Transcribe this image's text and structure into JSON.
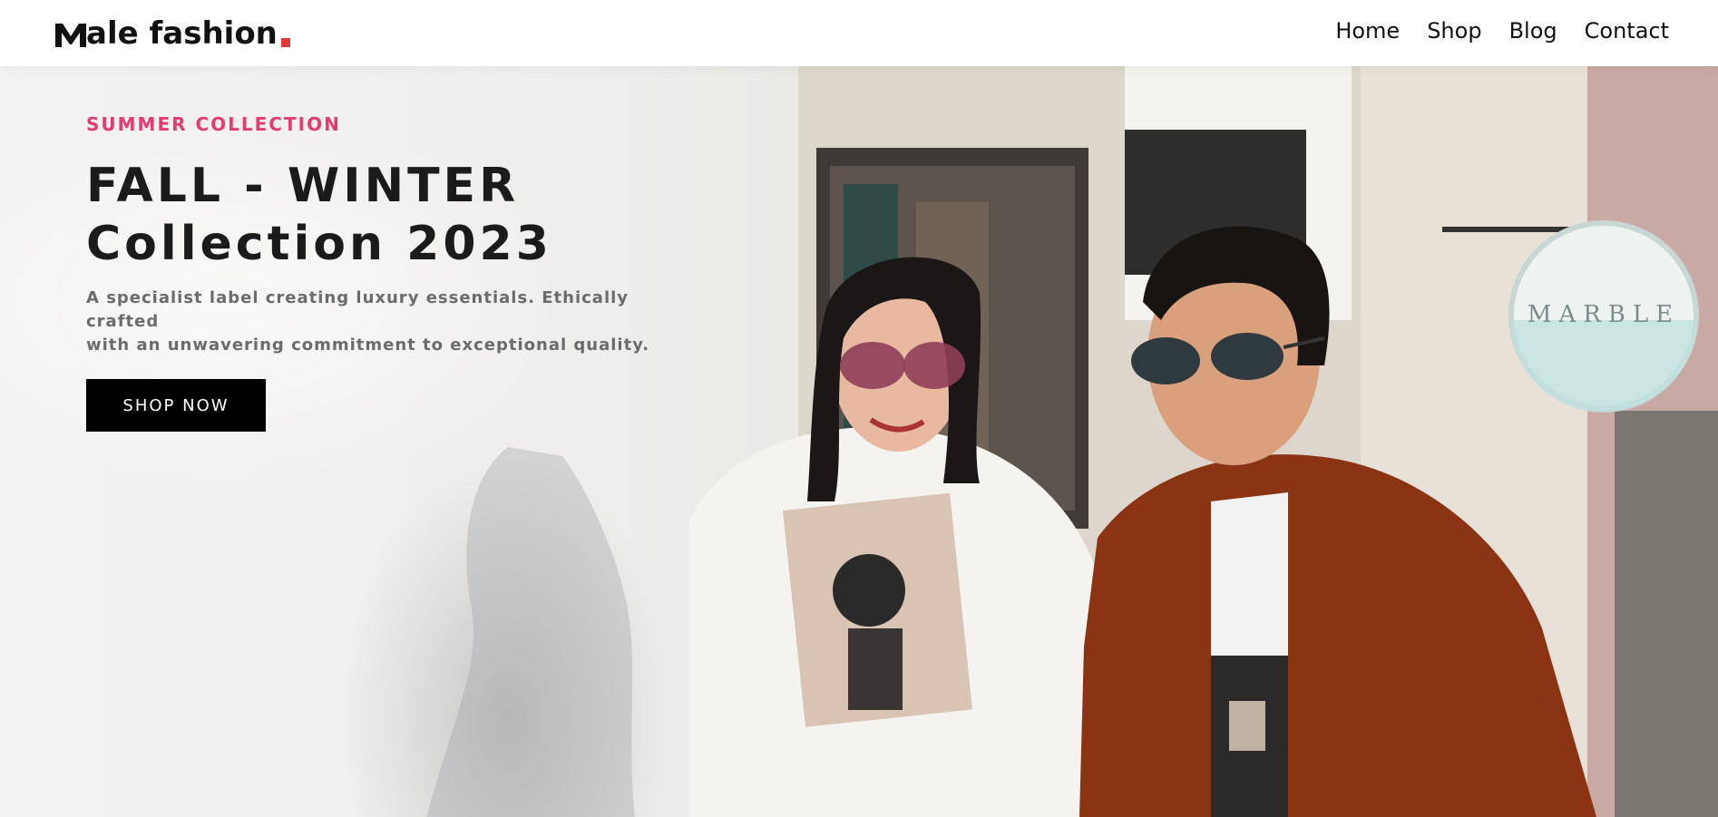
{
  "brand": {
    "name": "ale fashion",
    "mark_letter": "M",
    "accent_color": "#e53637"
  },
  "nav": {
    "items": [
      "Home",
      "Shop",
      "Blog",
      "Contact"
    ]
  },
  "hero": {
    "eyebrow": "SUMMER COLLECTION",
    "eyebrow_color": "#e53b72",
    "headline_line1": "FALL - WINTER",
    "headline_line2": "Collection 2023",
    "description_line1": "A specialist label creating luxury essentials. Ethically crafted",
    "description_line2": "with an unwavering commitment to exceptional quality.",
    "cta_label": "SHOP NOW",
    "image_subject": "couple-fashion-photo",
    "sign_text": "MARBLE"
  }
}
